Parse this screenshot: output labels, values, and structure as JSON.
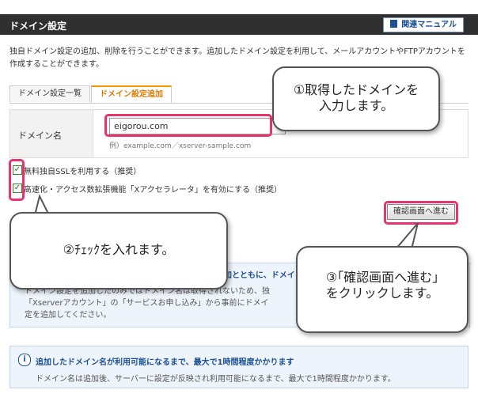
{
  "header": {
    "title": "ドメイン設定",
    "manual_button": "関連マニュアル"
  },
  "description": "独自ドメイン設定の追加、削除を行うことができます。追加したドメイン設定を利用して、メールアカウントやFTPアカウントを作成することができます。",
  "tabs": [
    {
      "label": "ドメイン設定一覧",
      "active": false
    },
    {
      "label": "ドメイン設定追加",
      "active": true
    }
  ],
  "form": {
    "domain_label": "ドメイン名",
    "domain_value": "eigorou.com",
    "example": "例）example.com／xserver-sample.com"
  },
  "options": [
    {
      "label": "無料独自SSLを利用する（推奨）",
      "checked": true
    },
    {
      "label": "高速化・アクセス数拡張機能「Xアクセラレータ」を有効にする（推奨）",
      "checked": true
    }
  ],
  "confirm_button": "確認画面へ進む",
  "notice1": {
    "heading": "加とともに、ドメイ",
    "text": "ドメイン設定を追加したのみではドメイン名は取得されないため、独\n「Xserverアカウント」の「サービスお申し込み」から事前にドメイ\n定を追加してください。"
  },
  "notice2": {
    "heading": "追加したドメイン名が利用可能になるまで、最大で1時間程度かかります",
    "text": "ドメイン名は追加後、サーバーに設定が反映され利用可能になるまで、最大で1時間程度かかります。"
  },
  "callouts": {
    "c1": "①取得したドメインを\n入力します。",
    "c2": "②ﾁｪｯｸを入れます。",
    "c3": "③｢確認画面へ進む｣\nをクリックします。"
  },
  "colors": {
    "header_bg": "#2f2f2f",
    "accent_orange": "#f39800",
    "highlight_pink": "#e8336d",
    "link_blue": "#1c4f93",
    "check_green": "#2d8a2d"
  }
}
